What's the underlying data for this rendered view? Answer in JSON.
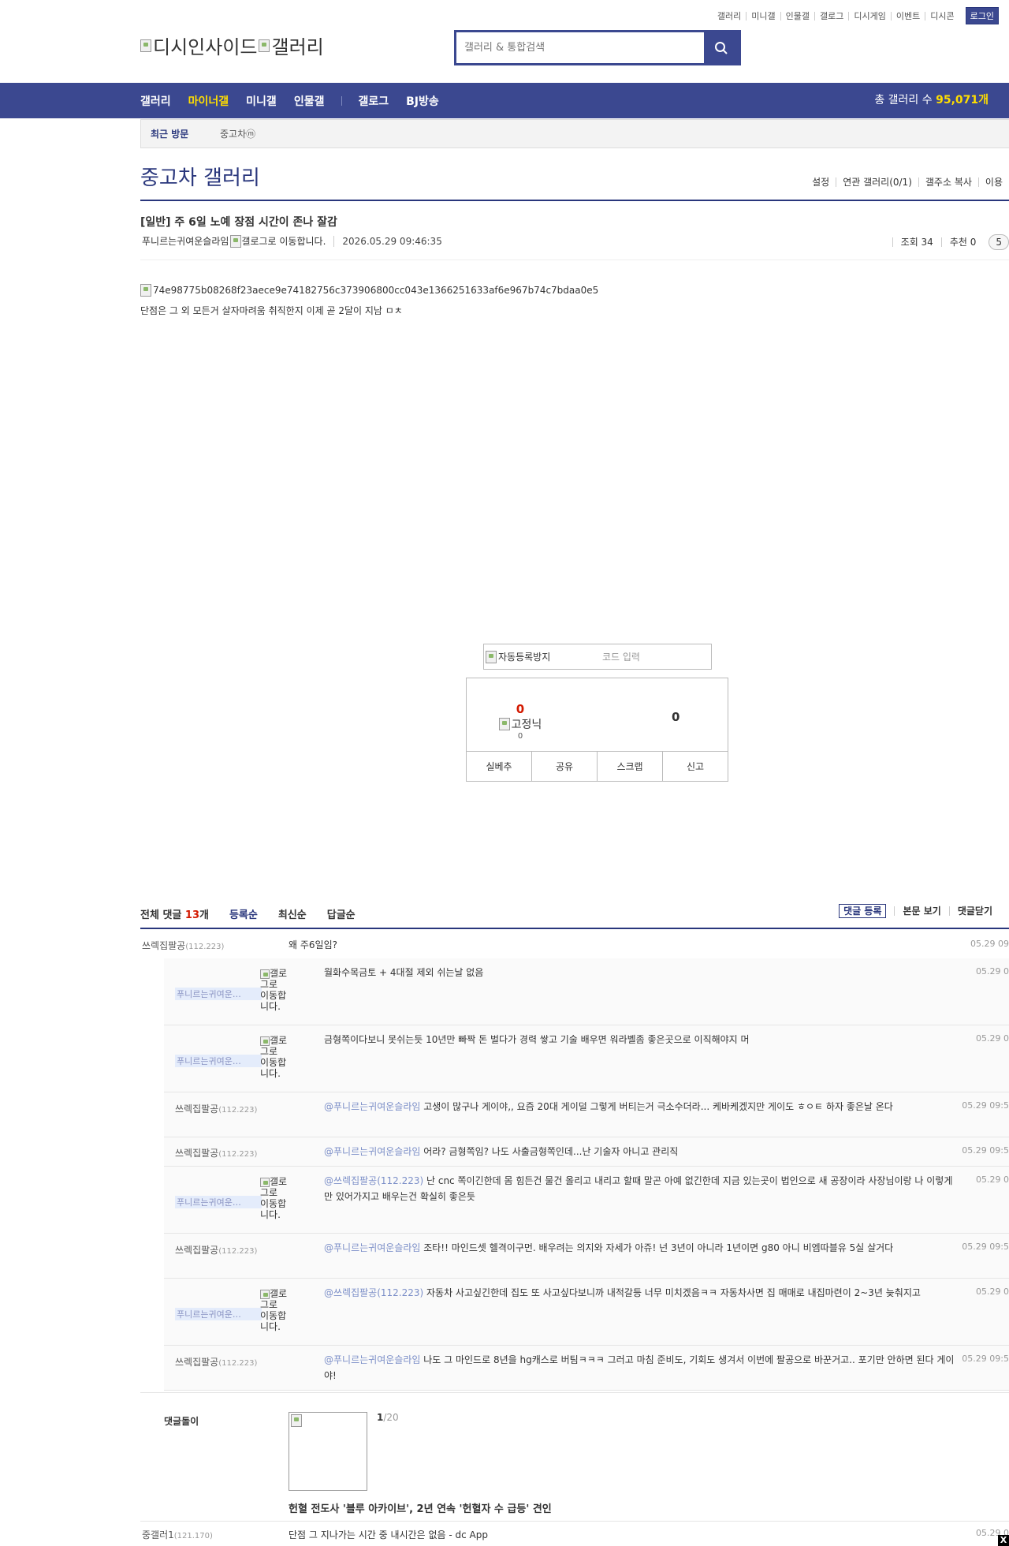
{
  "topnav": {
    "items": [
      "갤러리",
      "미니갤",
      "인물갤",
      "갤로그",
      "디시게임",
      "이벤트",
      "디시콘"
    ],
    "login": "로그인"
  },
  "logo": {
    "alt1": "디시인사이드",
    "alt2": "갤러리"
  },
  "search": {
    "placeholder": "갤러리 & 통합검색"
  },
  "gnb": {
    "items": [
      "갤러리",
      "마이너갤",
      "미니갤",
      "인물갤",
      "갤로그",
      "BJ방송"
    ],
    "active_index": 1,
    "total_label": "총 갤러리 수 ",
    "total_value": "95,071개"
  },
  "recent": {
    "label": "최근 방문",
    "item": "중고차ⓜ"
  },
  "gallery": {
    "title": "중고차 갤러리",
    "options": [
      "설정",
      "연관 갤러리(0/1)",
      "갤주소 복사",
      "이용"
    ]
  },
  "post": {
    "title": "[일반] 주 6일 노예 장점 시간이 존나 잘감",
    "author": "푸니르는귀여운슬라임",
    "gallog_alt": "갤로그로 이동합니다.",
    "date": "2026.05.29 09:46:35",
    "views": "조회 34",
    "recommend": "추천 0",
    "comment_pill": "5",
    "image_alt": "74e98775b08268f23aece9e74182756c373906800cc043e1366251633af6e967b74c7bdaa0e5",
    "text": "단점은 그 외 모든거 살자마려움  취직한지 이제 곧 2달이 지남 ㅁㅊ"
  },
  "captcha": {
    "img_alt": "자동등록방지",
    "placeholder": "코드 입력"
  },
  "recbox": {
    "up_count": "0",
    "fixed_label": "고정닉",
    "fixed_count": "0",
    "down_count": "0",
    "buttons": [
      "실베추",
      "공유",
      "스크랩",
      "신고"
    ]
  },
  "comments_header": {
    "total_prefix": "전체 댓글 ",
    "total_count": "13",
    "total_suffix": "개",
    "sorts": [
      "등록순",
      "최신순",
      "답글순"
    ],
    "right": [
      "댓글 등록",
      "본문 보기",
      "댓글닫기"
    ]
  },
  "comments": [
    {
      "nick": "쓰렉집팔공",
      "ip": "(112.223)",
      "text": "왜 주6일임?",
      "date": "05.29 09"
    }
  ],
  "replies": [
    {
      "nick": "푸니르는귀여운…",
      "fixed": true,
      "icon": "갤로그로 이동합니다.",
      "mention": "",
      "text": "월화수목금토 + 4대절 제외 쉬는날 없음",
      "date": "05.29 0"
    },
    {
      "nick": "푸니르는귀여운…",
      "fixed": true,
      "icon": "갤로그로 이동합니다.",
      "mention": "",
      "text": "금형쪽이다보니 못쉬는듯 10년만 빠짝 돈 벌다가 경력 쌓고 기술 배우면 워라벨좀 좋은곳으로 이직해야지 머",
      "date": "05.29 0"
    },
    {
      "nick": "쓰렉집팔공",
      "ip": "(112.223)",
      "fixed": false,
      "mention": "@푸니르는귀여운슬라임",
      "text": " 고생이 많구나 게이야,, 요즘 20대 게이덜 그렇게 버티는거 극소수더라... 케바케겠지만 게이도 ㅎㅇㅌ 하자 좋은날 온다",
      "date": "05.29 09:5"
    },
    {
      "nick": "쓰렉집팔공",
      "ip": "(112.223)",
      "fixed": false,
      "mention": "@푸니르는귀여운슬라임",
      "text": " 어라? 금형쪽임? 나도 사출금형쪽인데...난 기술자 아니고 관리직",
      "date": "05.29 09:5"
    },
    {
      "nick": "푸니르는귀여운…",
      "fixed": true,
      "icon": "갤로그로 이동합니다.",
      "mention": "@쓰렉집팔공(112.223)",
      "text": " 난 cnc 쪽이긴한데 몸 힘든건 물건 올리고 내리고 할때 말곤 아예 없긴한데 지금 있는곳이 법인으로 새 공장이라 사장님이랑 나 이렇게만 있어가지고 배우는건 확실히 좋은듯",
      "date": "05.29 0"
    },
    {
      "nick": "쓰렉집팔공",
      "ip": "(112.223)",
      "fixed": false,
      "mention": "@푸니르는귀여운슬라임",
      "text": " 조타!! 마인드셋 헬격이구먼. 배우려는 의지와 자세가 아쥬! 넌 3년이 아니라 1년이면 g80 아니 비엠따블유 5실 살거다",
      "date": "05.29 09:5"
    },
    {
      "nick": "푸니르는귀여운…",
      "fixed": true,
      "icon": "갤로그로 이동합니다.",
      "mention": "@쓰렉집팔공(112.223)",
      "text": " 자동차 사고싶긴한데 집도 또 사고싶다보니까 내적갈등 너무 미치겠음ㅋㅋ 자동차사면 집 매매로 내집마련이 2~3년 늦춰지고",
      "date": "05.29 0"
    },
    {
      "nick": "쓰렉집팔공",
      "ip": "(112.223)",
      "fixed": false,
      "mention": "@푸니르는귀여운슬라임",
      "text": " 나도 그 마인드로 8년을 hg캐스로 버팀ㅋㅋㅋ 그러고 마침 준비도, 기회도 생겨서 이번에 팔공으로 바꾼거고.. 포기만 안하면 된다 게이야!",
      "date": "05.29 09:5"
    }
  ],
  "bot": {
    "name": "댓글돌이",
    "count_cur": "1",
    "count_total": "/20",
    "headline": "헌혈 전도사 '블루 아카이브', 2년 연속 '헌혈자 수 급등' 견인"
  },
  "last_comment": {
    "nick": "중갤러1",
    "ip": "(121.170)",
    "text": "단점 그 지나가는 시간 중 내시간은 없음 - dc App",
    "date": "05.29 0"
  },
  "close_label": "X"
}
